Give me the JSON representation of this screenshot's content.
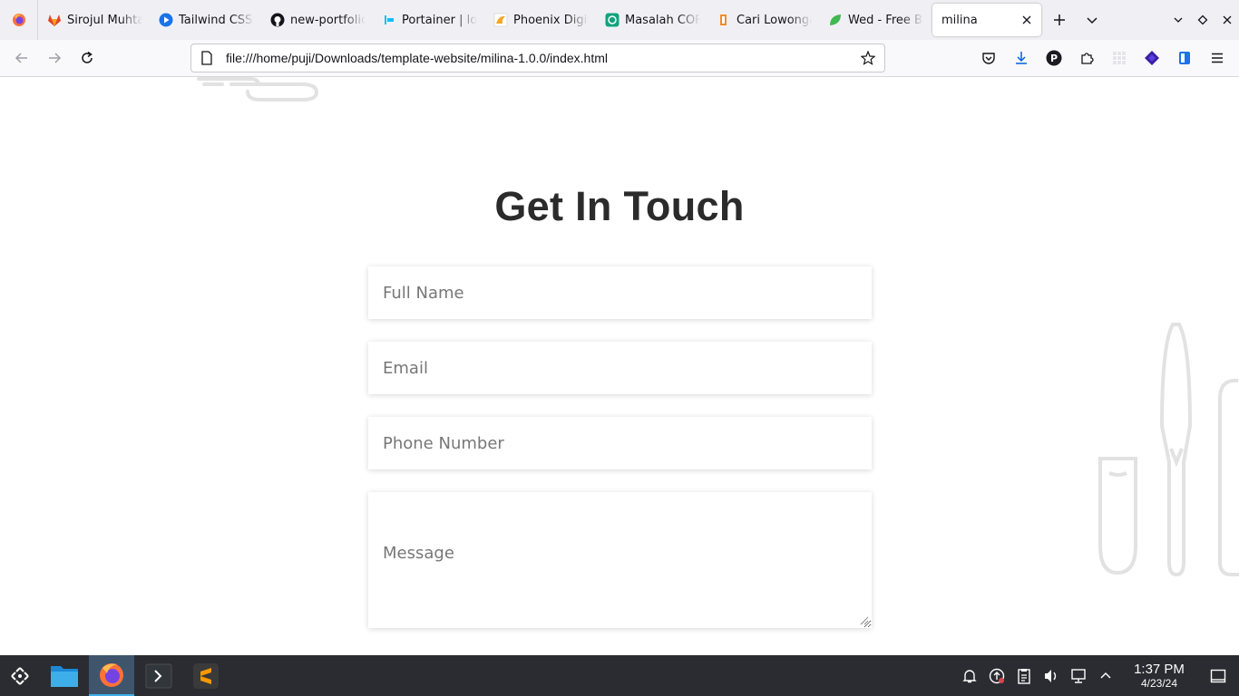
{
  "browser": {
    "tabs": [
      {
        "title": "Sirojul Muhtar",
        "icon": "gitlab-icon",
        "color": "#e24329"
      },
      {
        "title": "Tailwind CSS",
        "icon": "play-icon",
        "color": "#1a73e8"
      },
      {
        "title": "new-portfolio",
        "icon": "github-icon",
        "color": "#15141a"
      },
      {
        "title": "Portainer | lo",
        "icon": "portainer-icon",
        "color": "#13bef9"
      },
      {
        "title": "Phoenix Digital",
        "icon": "phoenix-icon",
        "color": "#f5a623"
      },
      {
        "title": "Masalah CORS",
        "icon": "chatgpt-icon",
        "color": "#10a37f"
      },
      {
        "title": "Cari Lowongan",
        "icon": "glints-icon",
        "color": "#f28c28"
      },
      {
        "title": "Wed - Free Bo",
        "icon": "leaf-icon",
        "color": "#3fb950"
      }
    ],
    "active_tab": {
      "title": "milina"
    },
    "url": "file:///home/puji/Downloads/template-website/milina-1.0.0/index.html",
    "accent_color": "#0061e0"
  },
  "page": {
    "title": "Get In Touch",
    "form": {
      "full_name_placeholder": "Full Name",
      "email_placeholder": "Email",
      "phone_placeholder": "Phone Number",
      "message_placeholder": "Message"
    },
    "deco_color": "#e2e2e2"
  },
  "taskbar": {
    "time": "1:37 PM",
    "date": "4/23/24",
    "apps": [
      "application-launcher-icon",
      "file-manager-icon",
      "firefox-icon",
      "terminal-icon",
      "sublime-text-icon"
    ]
  }
}
